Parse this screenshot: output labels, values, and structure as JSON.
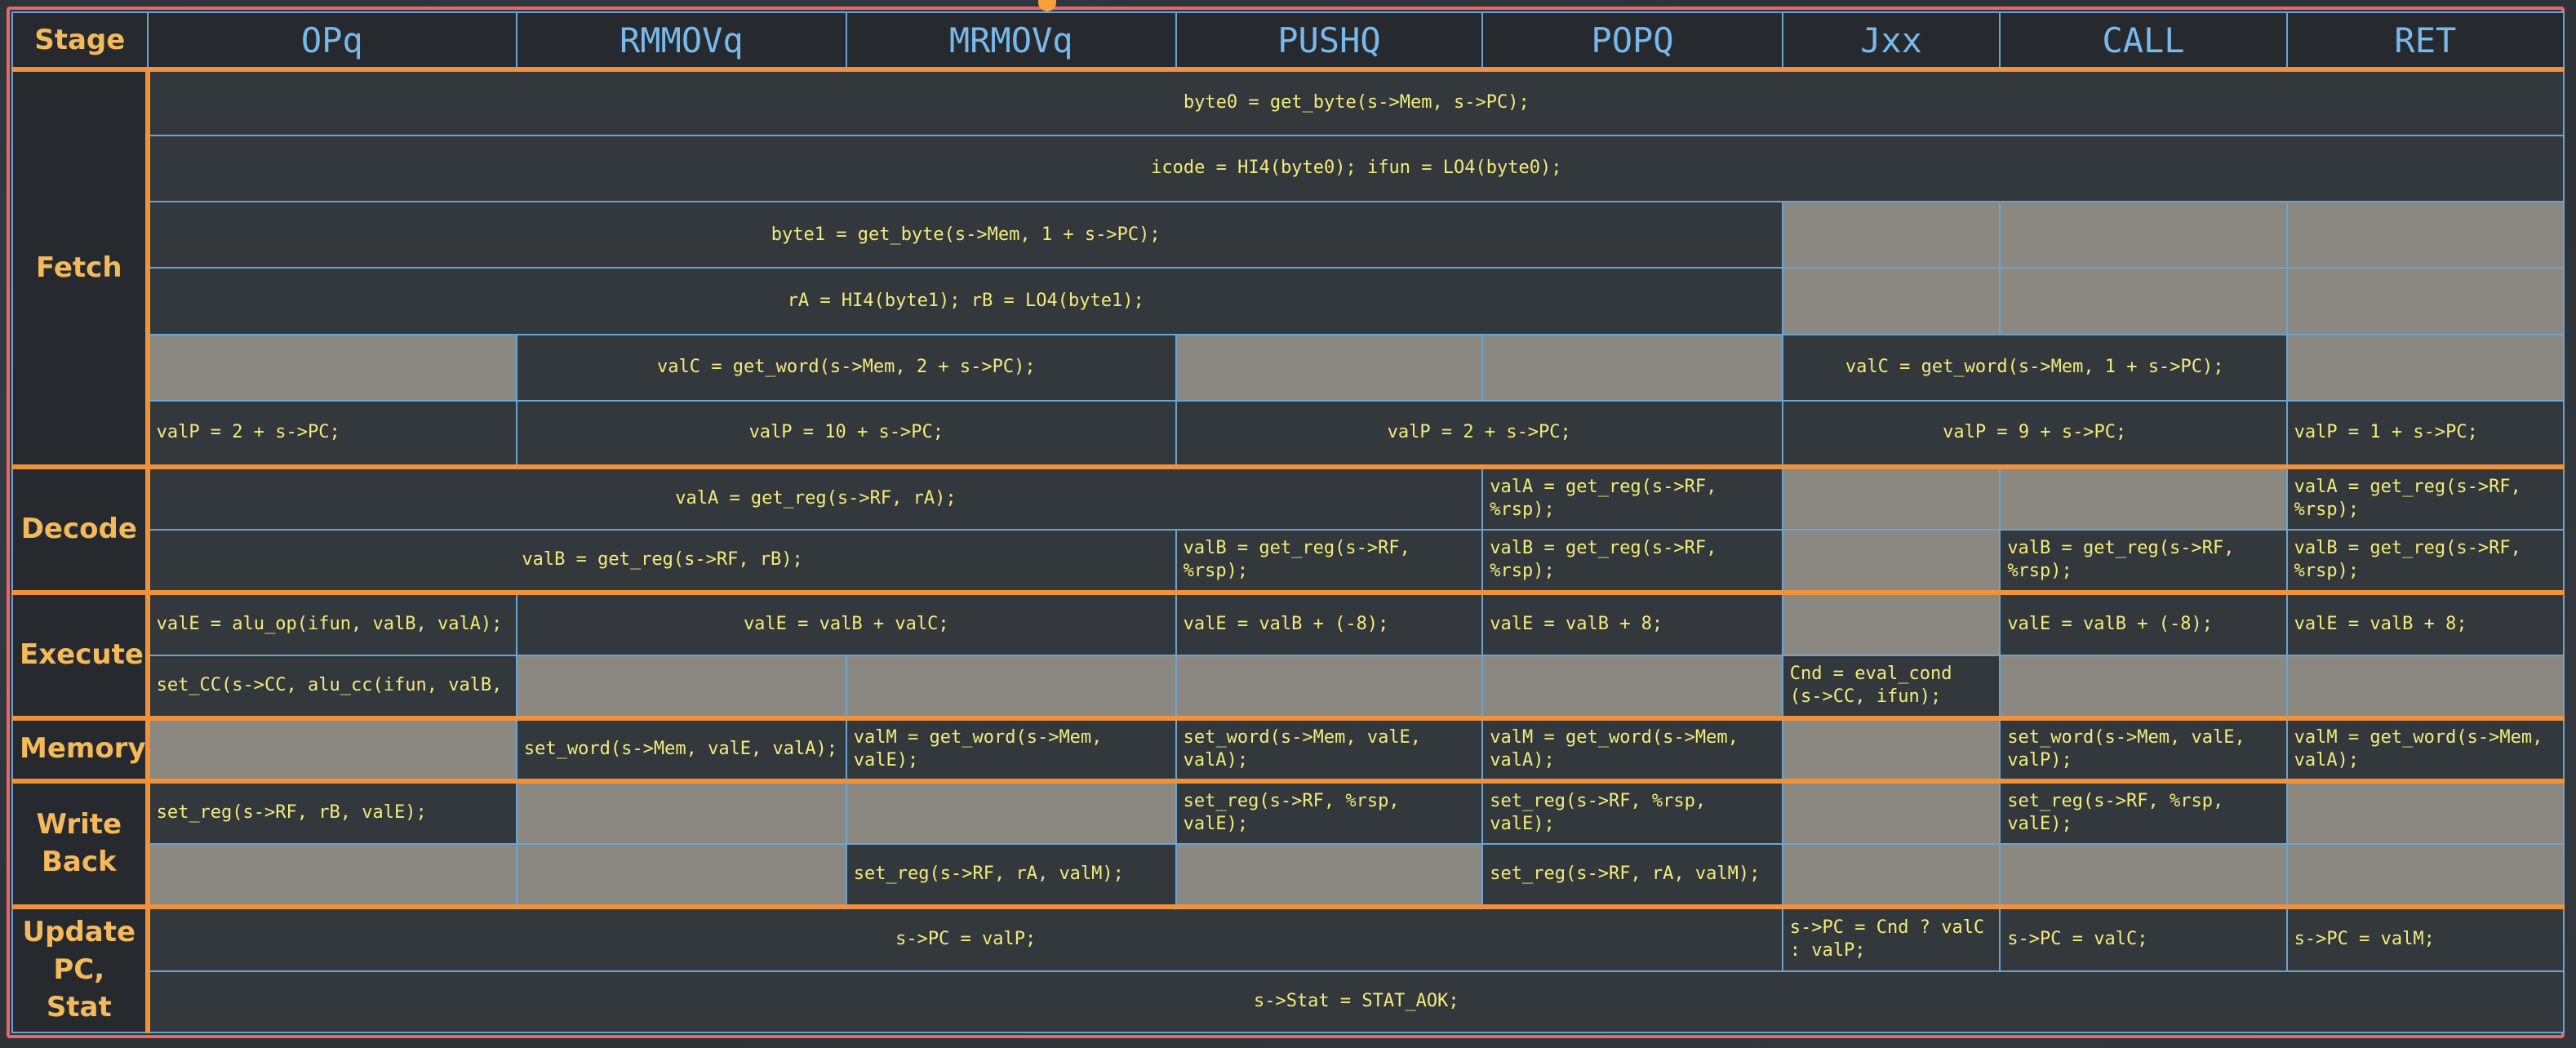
{
  "columns": [
    "Stage",
    "OPq",
    "RMMOVq",
    "MRMOVq",
    "PUSHQ",
    "POPQ",
    "Jxx",
    "CALL",
    "RET"
  ],
  "stages": {
    "fetch": "Fetch",
    "decode": "Decode",
    "execute": "Execute",
    "memory": "Memory",
    "writeback": "Write\nBack",
    "update": "Update\nPC, Stat"
  },
  "fetch": {
    "byte0": "byte0 = get_byte(s->Mem, s->PC);",
    "icode": "icode = HI4(byte0); ifun = LO4(byte0);",
    "byte1": "byte1 = get_byte(s->Mem, 1 + s->PC);",
    "rarb": "rA = HI4(byte1); rB = LO4(byte1);",
    "valc_10": "valC = get_word(s->Mem, 2 + s->PC);",
    "valc_jxx": "valC = get_word(s->Mem, 1 + s->PC);",
    "valp_opq": "valP = 2 + s->PC;",
    "valp_10": "valP = 10 + s->PC;",
    "valp_2": "valP = 2 + s->PC;",
    "valp_9": "valP = 9 + s->PC;",
    "valp_ret": "valP = 1 + s->PC;"
  },
  "decode": {
    "vala_ra": "valA = get_reg(s->RF, rA);",
    "vala_popq": "valA = get_reg(s->RF, %rsp);",
    "vala_ret": "valA = get_reg(s->RF, %rsp);",
    "valb_rb": "valB = get_reg(s->RF, rB);",
    "valb_pushq": "valB = get_reg(s->RF, %rsp);",
    "valb_popq": "valB = get_reg(s->RF, %rsp);",
    "valb_call": "valB = get_reg(s->RF, %rsp);",
    "valb_ret": "valB = get_reg(s->RF, %rsp);"
  },
  "execute": {
    "opq": "valE = alu_op(ifun, valB, valA);",
    "valc": "valE = valB + valC;",
    "pushq": "valE = valB + (-8);",
    "popq": "valE = valB + 8;",
    "call": "valE = valB + (-8);",
    "ret": "valE = valB + 8;",
    "setcc": "set_CC(s->CC, alu_cc(ifun, valB,",
    "cnd": "Cnd = eval_cond (s->CC, ifun);"
  },
  "memory": {
    "rmmovq": "set_word(s->Mem, valE, valA);",
    "mrmovq": "valM = get_word(s->Mem, valE);",
    "pushq": "set_word(s->Mem, valE, valA);",
    "popq": "valM = get_word(s->Mem, valA);",
    "call": "set_word(s->Mem, valE, valP);",
    "ret": "valM = get_word(s->Mem, valA);"
  },
  "writeback": {
    "opq": "set_reg(s->RF, rB, valE);",
    "pushq": "set_reg(s->RF, %rsp, valE);",
    "popq_e": "set_reg(s->RF, %rsp, valE);",
    "call": "set_reg(s->RF, %rsp, valE);",
    "mrmovq": "set_reg(s->RF, rA, valM);",
    "popq_m": "set_reg(s->RF, rA, valM);"
  },
  "update": {
    "pc_valp": "s->PC = valP;",
    "pc_jxx": "s->PC = Cnd ? valC : valP;",
    "pc_call": "s->PC = valC;",
    "pc_ret": "s->PC = valM;",
    "stat": "s->Stat = STAT_AOK;"
  },
  "colors": {
    "chalkboard": "#2e3338",
    "code_text": "#f1ec7a",
    "header_text": "#78b9ec",
    "stage_text": "#f4b95a",
    "stage_border": "#f0923c",
    "cell_border": "#6aa4d2",
    "empty_cell": "#8a8881",
    "frame": "#e9666b"
  }
}
